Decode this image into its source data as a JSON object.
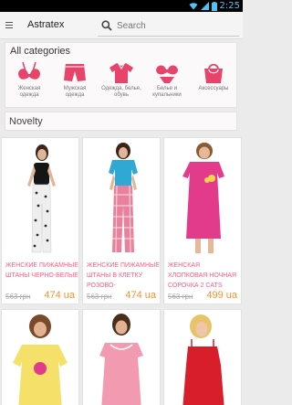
{
  "status_bar": {
    "time": "2:25"
  },
  "toolbar": {
    "title": "Astratex",
    "search_placeholder": "Search"
  },
  "categories": {
    "title": "All categories",
    "items": [
      {
        "label": "Женская одежда",
        "icon": "bra-icon"
      },
      {
        "label": "Мужская одежда",
        "icon": "shorts-icon"
      },
      {
        "label": "Одежда, белье, обувь",
        "icon": "shirt-icon"
      },
      {
        "label": "Белье и купальники",
        "icon": "lingerie-icon"
      },
      {
        "label": "Аксессуары",
        "icon": "bag-icon"
      }
    ]
  },
  "novelty": {
    "title": "Novelty"
  },
  "products": [
    {
      "name": "ЖЕНСКИЕ ПИЖАМНЫЕ ШТАНЫ ЧЕРНО-БЕЛЫЕ",
      "old_price": "563 грн",
      "price": "474 ua"
    },
    {
      "name": "ЖЕНСКИЕ ПИЖАМНЫЕ ШТАНЫ В КЛЕТКУ РОЗОВО-",
      "old_price": "563 грн",
      "price": "474 ua"
    },
    {
      "name": "ЖЕНСКАЯ ХЛОПКОВАЯ НОЧНАЯ СОРОЧКА 2 CATS",
      "old_price": "563 грн",
      "price": "499 ua"
    },
    {
      "name": "",
      "old_price": "",
      "price": ""
    },
    {
      "name": "",
      "old_price": "",
      "price": ""
    },
    {
      "name": "",
      "old_price": "",
      "price": ""
    }
  ],
  "colors": {
    "accent": "#e8436b",
    "price": "#f0952e",
    "name": "#ff5a7e"
  }
}
